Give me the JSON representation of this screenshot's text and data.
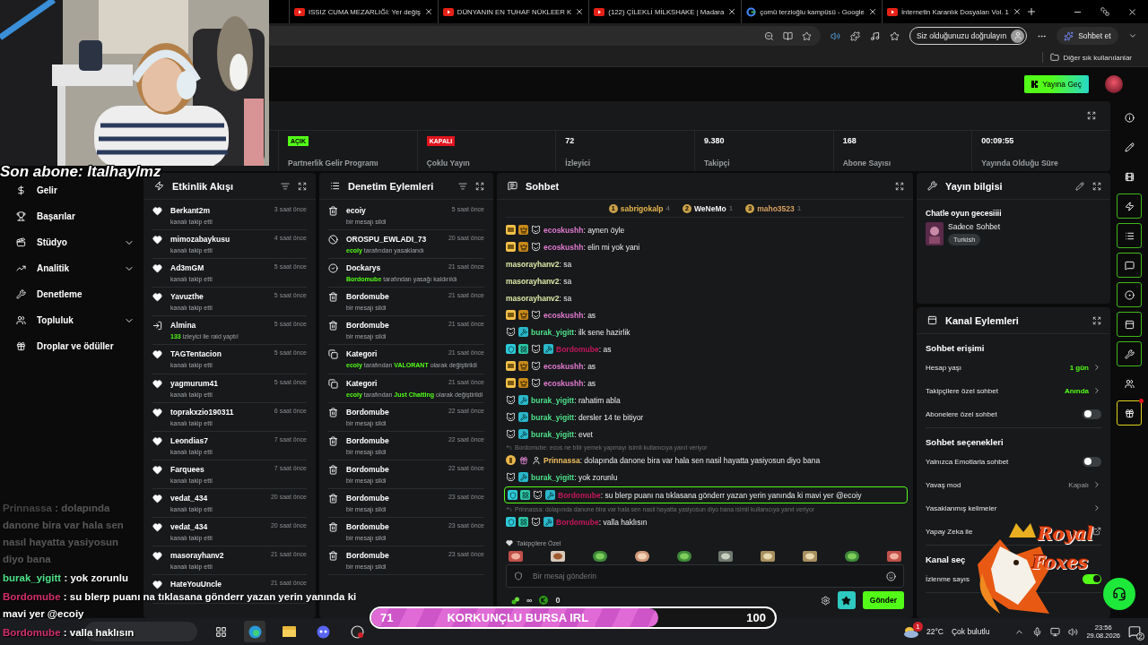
{
  "browser": {
    "tabs": [
      {
        "kind": "youtube",
        "title": "ISSIZ CUMA MEZARLIĞI: Yer değiş"
      },
      {
        "kind": "youtube",
        "title": "DÜNYANIN EN TUHAF NÜKLEER K"
      },
      {
        "kind": "youtube",
        "title": "(122) ÇİLEKLİ MİLKSHAKE | Madara"
      },
      {
        "kind": "google",
        "title": "çomü terzioğlu kampüsü - Google"
      },
      {
        "kind": "youtube",
        "title": "İnternetin Karanlık Dosyaları Vol. 1"
      }
    ],
    "verify_button": "Siz olduğunuzu doğrulayın",
    "copilot_button": "Sohbet et",
    "bookmarks_folder": "Diğer sık kullanılanlar"
  },
  "header": {
    "go_live_button": "Yayına Geç"
  },
  "nav": [
    {
      "label": "Gelir",
      "submenu": false
    },
    {
      "label": "Başarılar",
      "submenu": false
    },
    {
      "label": "Stüdyo",
      "submenu": true
    },
    {
      "label": "Analitik",
      "submenu": true
    },
    {
      "label": "Denetleme",
      "submenu": false
    },
    {
      "label": "Topluluk",
      "submenu": true
    },
    {
      "label": "Droplar ve ödüller",
      "submenu": false
    }
  ],
  "stats": [
    {
      "kind": "status",
      "badge": "AÇIK",
      "on": true,
      "label": "Partnerlik Gelir Programı"
    },
    {
      "kind": "status",
      "badge": "KAPALI",
      "on": false,
      "label": "Çoklu Yayın"
    },
    {
      "kind": "number",
      "value": "72",
      "label": "İzleyici"
    },
    {
      "kind": "number",
      "value": "9.380",
      "label": "Takipçi"
    },
    {
      "kind": "number",
      "value": "168",
      "label": "Abone Sayısı"
    },
    {
      "kind": "number",
      "value": "00:09:55",
      "label": "Yayında Olduğu Süre"
    }
  ],
  "activity": {
    "title": "Etkinlik Akışı",
    "items": [
      {
        "kind": "follow",
        "user": "Berkant2m",
        "time": "3 saat önce",
        "detail": [
          {
            "text": "kanalı takip etti",
            "highlight": false
          }
        ]
      },
      {
        "kind": "follow",
        "user": "mimozabaykusu",
        "time": "4 saat önce",
        "detail": [
          {
            "text": "kanalı takip etti",
            "highlight": false
          }
        ]
      },
      {
        "kind": "follow",
        "user": "Ad3mGM",
        "time": "5 saat önce",
        "detail": [
          {
            "text": "kanalı takip etti",
            "highlight": false
          }
        ]
      },
      {
        "kind": "follow",
        "user": "Yavuzthe",
        "time": "5 saat önce",
        "detail": [
          {
            "text": "kanalı takip etti",
            "highlight": false
          }
        ]
      },
      {
        "kind": "raid",
        "user": "Almina",
        "time": "5 saat önce",
        "detail": [
          {
            "text": "133",
            "highlight": true
          },
          {
            "text": " izleyici ile raid yaptı!",
            "highlight": false
          }
        ]
      },
      {
        "kind": "follow",
        "user": "TAGTentacion",
        "time": "5 saat önce",
        "detail": [
          {
            "text": "kanalı takip etti",
            "highlight": false
          }
        ]
      },
      {
        "kind": "follow",
        "user": "yagmurum41",
        "time": "5 saat önce",
        "detail": [
          {
            "text": "kanalı takip etti",
            "highlight": false
          }
        ]
      },
      {
        "kind": "follow",
        "user": "toprakxzio190311",
        "time": "6 saat önce",
        "detail": [
          {
            "text": "kanalı takip etti",
            "highlight": false
          }
        ]
      },
      {
        "kind": "follow",
        "user": "Leondias7",
        "time": "7 saat önce",
        "detail": [
          {
            "text": "kanalı takip etti",
            "highlight": false
          }
        ]
      },
      {
        "kind": "follow",
        "user": "Farquees",
        "time": "7 saat önce",
        "detail": [
          {
            "text": "kanalı takip etti",
            "highlight": false
          }
        ]
      },
      {
        "kind": "follow",
        "user": "vedat_434",
        "time": "20 saat önce",
        "detail": [
          {
            "text": "kanalı takip etti",
            "highlight": false
          }
        ]
      },
      {
        "kind": "follow",
        "user": "vedat_434",
        "time": "20 saat önce",
        "detail": [
          {
            "text": "kanalı takip etti",
            "highlight": false
          }
        ]
      },
      {
        "kind": "follow",
        "user": "masorayhanv2",
        "time": "21 saat önce",
        "detail": [
          {
            "text": "kanalı takip etti",
            "highlight": false
          }
        ]
      },
      {
        "kind": "follow",
        "user": "HateYouUncle",
        "time": "21 saat önce"
      }
    ]
  },
  "moderation": {
    "title": "Denetim Eylemleri",
    "items": [
      {
        "kind": "delete",
        "user": "ecoiy",
        "time": "5 saat önce",
        "detail": [
          {
            "text": "bir mesajı sildi",
            "highlight": false
          }
        ]
      },
      {
        "kind": "ban",
        "user": "OROSPU_EWLADI_73",
        "time": "20 saat önce",
        "detail": [
          {
            "text": "ecoiy",
            "highlight": true
          },
          {
            "text": " tarafından yasaklandı",
            "highlight": false
          }
        ]
      },
      {
        "kind": "unban",
        "user": "Dockarys",
        "time": "21 saat önce",
        "detail": [
          {
            "text": "Bordomube",
            "highlight": true
          },
          {
            "text": " tarafından yasağı kaldırıldı",
            "highlight": false
          }
        ]
      },
      {
        "kind": "delete",
        "user": "Bordomube",
        "time": "21 saat önce",
        "detail": [
          {
            "text": "bir mesajı sildi",
            "highlight": false
          }
        ]
      },
      {
        "kind": "delete",
        "user": "Bordomube",
        "time": "21 saat önce",
        "detail": [
          {
            "text": "bir mesajı sildi",
            "highlight": false
          }
        ]
      },
      {
        "kind": "category",
        "user": "Kategori",
        "time": "21 saat önce",
        "detail": [
          {
            "text": "ecoiy",
            "highlight": true
          },
          {
            "text": " tarafından ",
            "highlight": false
          },
          {
            "text": "VALORANT",
            "highlight": true
          },
          {
            "text": " olarak değiştirildi",
            "highlight": false
          }
        ]
      },
      {
        "kind": "category",
        "user": "Kategori",
        "time": "21 saat önce",
        "detail": [
          {
            "text": "ecoiy",
            "highlight": true
          },
          {
            "text": " tarafından ",
            "highlight": false
          },
          {
            "text": "Just Chatting",
            "highlight": true
          },
          {
            "text": " olarak değiştirildi",
            "highlight": false
          }
        ]
      },
      {
        "kind": "delete",
        "user": "Bordomube",
        "time": "22 saat önce",
        "detail": [
          {
            "text": "bir mesajı sildi",
            "highlight": false
          }
        ]
      },
      {
        "kind": "delete",
        "user": "Bordomube",
        "time": "22 saat önce",
        "detail": [
          {
            "text": "bir mesajı sildi",
            "highlight": false
          }
        ]
      },
      {
        "kind": "delete",
        "user": "Bordomube",
        "time": "22 saat önce",
        "detail": [
          {
            "text": "bir mesajı sildi",
            "highlight": false
          }
        ]
      },
      {
        "kind": "delete",
        "user": "Bordomube",
        "time": "23 saat önce",
        "detail": [
          {
            "text": "bir mesajı sildi",
            "highlight": false
          }
        ]
      },
      {
        "kind": "delete",
        "user": "Bordomube",
        "time": "23 saat önce",
        "detail": [
          {
            "text": "bir mesajı sildi",
            "highlight": false
          }
        ]
      },
      {
        "kind": "delete",
        "user": "Bordomube",
        "time": "23 saat önce",
        "detail": [
          {
            "text": "bir mesajı sildi",
            "highlight": false
          }
        ]
      }
    ]
  },
  "chat": {
    "title": "Sohbet",
    "top_chatters": [
      {
        "rank": "1",
        "name": "sabrigokalp",
        "count": "4",
        "color": "#e8b64c"
      },
      {
        "rank": "2",
        "name": "WeNeMo",
        "count": "1",
        "color": "#f2f2f2"
      },
      {
        "rank": "3",
        "name": "maho3523",
        "count": "1",
        "color": "#d9a060"
      }
    ],
    "messages": [
      {
        "user": "ecoskushh",
        "color": "#e07ad0",
        "badges": [
          {
            "kind": "sub"
          },
          {
            "kind": "crown"
          },
          {
            "kind": "cat"
          }
        ],
        "text": ": aynen öyle",
        "highlighted": false
      },
      {
        "user": "ecoskushh",
        "color": "#e07ad0",
        "badges": [
          {
            "kind": "sub"
          },
          {
            "kind": "crown"
          },
          {
            "kind": "cat"
          }
        ],
        "text": ": elin mi yok yani",
        "highlighted": false
      },
      {
        "user": "masorayhanv2",
        "color": "#dfe9a8",
        "text": ": sa",
        "highlighted": false
      },
      {
        "user": "masorayhanv2",
        "color": "#dfe9a8",
        "text": ": sa",
        "highlighted": false
      },
      {
        "user": "masorayhanv2",
        "color": "#dfe9a8",
        "text": ": sa",
        "highlighted": false
      },
      {
        "user": "ecoskushh",
        "color": "#e07ad0",
        "badges": [
          {
            "kind": "sub"
          },
          {
            "kind": "crown"
          },
          {
            "kind": "cat"
          }
        ],
        "text": ": as",
        "highlighted": false
      },
      {
        "user": "burak_yigitt",
        "color": "#4fe08a",
        "badges": [
          {
            "kind": "cat"
          },
          {
            "kind": "mod"
          }
        ],
        "text": ": ilk sene hazirlik",
        "highlighted": false
      },
      {
        "user": "Bordomube",
        "color": "#c2185b",
        "badges": [
          {
            "kind": "shield"
          },
          {
            "kind": "og"
          },
          {
            "kind": "cat"
          },
          {
            "kind": "mod"
          }
        ],
        "text": ": as",
        "highlighted": false
      },
      {
        "user": "ecoskushh",
        "color": "#e07ad0",
        "badges": [
          {
            "kind": "sub"
          },
          {
            "kind": "crown"
          },
          {
            "kind": "cat"
          }
        ],
        "text": ": as",
        "highlighted": false
      },
      {
        "user": "ecoskushh",
        "color": "#e07ad0",
        "badges": [
          {
            "kind": "sub"
          },
          {
            "kind": "crown"
          },
          {
            "kind": "cat"
          }
        ],
        "text": ": as",
        "highlighted": false
      },
      {
        "user": "burak_yigitt",
        "color": "#4fe08a",
        "badges": [
          {
            "kind": "cat"
          },
          {
            "kind": "mod"
          }
        ],
        "text": ": rahatim abla",
        "highlighted": false
      },
      {
        "user": "burak_yigitt",
        "color": "#4fe08a",
        "badges": [
          {
            "kind": "cat"
          },
          {
            "kind": "mod"
          }
        ],
        "text": ": dersler 14 te bitiyor",
        "highlighted": false
      },
      {
        "user": "burak_yigitt",
        "color": "#4fe08a",
        "badges": [
          {
            "kind": "cat"
          },
          {
            "kind": "mod"
          }
        ],
        "text": ": evet",
        "highlighted": false
      },
      {
        "reply": "Bordomube: ecos ne bilir yemek yapmayı isimli kullanıcıya yanıt veriyor",
        "user": "Prinnassa",
        "color": "#f2c060",
        "badges": [
          {
            "kind": "rank"
          },
          {
            "kind": "gift"
          },
          {
            "kind": "figure"
          }
        ],
        "text": ": dolapında danone bira var hala sen nasil hayatta yasiyosun diyo bana",
        "highlighted": false
      },
      {
        "user": "burak_yigitt",
        "color": "#4fe08a",
        "badges": [
          {
            "kind": "cat"
          },
          {
            "kind": "mod"
          }
        ],
        "text": ": yok zorunlu",
        "highlighted": false
      },
      {
        "user": "Bordomube",
        "color": "#c2185b",
        "badges": [
          {
            "kind": "shield"
          },
          {
            "kind": "og"
          },
          {
            "kind": "cat"
          },
          {
            "kind": "mod"
          }
        ],
        "text": ": su blerp puanı na tıklasana gönderr yazan yerin yanında ki mavi yer @ecoiy",
        "highlighted": true
      },
      {
        "reply": "Prinnassa: dolapında danone bira var hala sen nasil hayatta yasiyosun diyo bana isimli kullanıcıya yanıt veriyor",
        "user": "Bordomube",
        "color": "#c2185b",
        "badges": [
          {
            "kind": "shield"
          },
          {
            "kind": "og"
          },
          {
            "kind": "cat"
          },
          {
            "kind": "mod"
          }
        ],
        "text": ": valla haklısın",
        "highlighted": false
      }
    ],
    "emote_section": "Takipçilere Özel",
    "emotes": [
      {
        "kind": "face"
      },
      {
        "kind": "food"
      },
      {
        "kind": "frog"
      },
      {
        "kind": "blob"
      },
      {
        "kind": "frog"
      },
      {
        "kind": "group"
      },
      {
        "kind": "scene"
      },
      {
        "kind": "scene"
      },
      {
        "kind": "frog"
      },
      {
        "kind": "face"
      }
    ],
    "input": {
      "placeholder": "Bir mesaj gönderin"
    },
    "channel_points": "∞",
    "kick_points": "0",
    "send_button": "Gönder"
  },
  "stream_info": {
    "title": "Yayın bilgisi",
    "stream_title": "Chatle oyun gecesiiii",
    "category": "Sadece Sohbet",
    "tag": "Turkish"
  },
  "channel_actions": {
    "title": "Kanal Eylemleri",
    "sections": [
      {
        "heading": "Sohbet erişimi",
        "rows": [
          {
            "kind": "link",
            "label": "Hesap yaşı",
            "value": "1 gün",
            "highlight": true
          },
          {
            "kind": "link",
            "label": "Takipçilere özel sohbet",
            "value": "Anında",
            "highlight": true
          },
          {
            "kind": "toggle",
            "label": "Abonelere özel sohbet",
            "on": false
          }
        ]
      },
      {
        "heading": "Sohbet seçenekleri",
        "rows": [
          {
            "kind": "toggle",
            "label": "Yalnızca Emotlarla sohbet",
            "on": false
          },
          {
            "kind": "link",
            "label": "Yavaş mod",
            "value": "Kapalı",
            "highlight": false
          },
          {
            "kind": "link",
            "label": "Yasaklanmış kelimeler"
          },
          {
            "kind": "external",
            "label": "Yapay Zeka ile"
          }
        ]
      },
      {
        "heading": "Kanal seç",
        "rows": [
          {
            "kind": "toggle",
            "label": "İzlenme sayıs",
            "on": true
          }
        ]
      }
    ]
  },
  "rail": [
    {
      "kind": "info",
      "framed": false,
      "alert": false
    },
    {
      "kind": "edit",
      "framed": false,
      "alert": false
    },
    {
      "kind": "film",
      "framed": false,
      "alert": false
    },
    {
      "kind": "zap",
      "framed": true,
      "alert": false
    },
    {
      "kind": "list",
      "framed": true,
      "alert": false
    },
    {
      "kind": "chat",
      "framed": true,
      "alert": false
    },
    {
      "kind": "record",
      "framed": true,
      "alert": false
    },
    {
      "kind": "panel",
      "framed": true,
      "alert": false
    },
    {
      "kind": "wrench",
      "framed": true,
      "alert": false
    },
    {
      "kind": "dots",
      "framed": false,
      "alert": false
    },
    {
      "kind": "gift",
      "framed": true,
      "alert": true
    }
  ],
  "overlay": {
    "last_sub": "Son abone: Italhaylmz",
    "chat": [
      {
        "user": "Prinnassa",
        "text": " : dolapında danone bira var hala sen nasıl hayatta yasiyosun diyo bana",
        "faded": true
      },
      {
        "user": "burak_yigitt",
        "color": "#4fe08a",
        "text": " : yok zorunlu",
        "faded": false
      },
      {
        "user": "Bordomube",
        "color": "#d0306a",
        "text": " : su blerp puanı na tıklasana gönderr yazan yerin yanında ki mavi yer @ecoiy",
        "faded": false
      },
      {
        "user": "Bordomube",
        "color": "#d0306a",
        "text": " : valla haklısın",
        "faded": false
      }
    ],
    "goal": {
      "current": "71",
      "title": "KORKUNÇLU BURSA IRL",
      "target": "100",
      "level": 0.71
    },
    "logo_words": [
      "Royal",
      "Foxes"
    ]
  },
  "taskbar": {
    "weather_badge": "1",
    "temperature": "22°C",
    "weather": "Çok bulutlu",
    "time": "23:56",
    "date": "29.08.2026",
    "notifications": "2"
  }
}
